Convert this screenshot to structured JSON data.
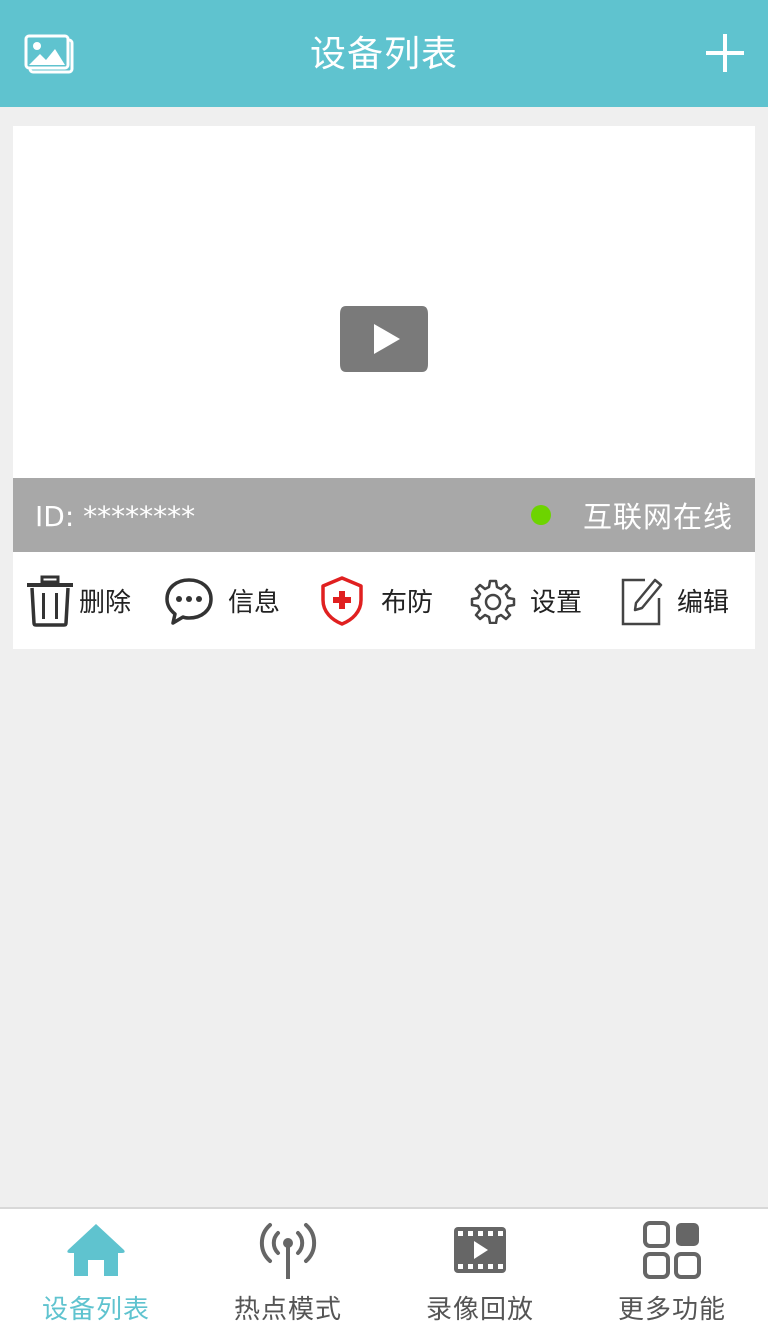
{
  "header": {
    "title": "设备列表",
    "left_icon": "gallery-icon",
    "right_icon": "plus-icon"
  },
  "device": {
    "id_label": "ID: ********",
    "status": "互联网在线",
    "status_color": "#6dd400",
    "play_icon": "play-icon",
    "actions": [
      {
        "label": "删除",
        "icon": "trash-icon"
      },
      {
        "label": "信息",
        "icon": "chat-bubble-icon"
      },
      {
        "label": "布防",
        "icon": "shield-icon"
      },
      {
        "label": "设置",
        "icon": "gear-icon"
      },
      {
        "label": "编辑",
        "icon": "edit-icon"
      }
    ]
  },
  "bottom_nav": {
    "items": [
      {
        "label": "设备列表",
        "icon": "home-icon",
        "active": true
      },
      {
        "label": "热点模式",
        "icon": "antenna-icon",
        "active": false
      },
      {
        "label": "录像回放",
        "icon": "video-playback-icon",
        "active": false
      },
      {
        "label": "更多功能",
        "icon": "grid-icon",
        "active": false
      }
    ]
  },
  "colors": {
    "accent": "#5fc3cf",
    "info_bar": "#a8a8a8",
    "background": "#efefef",
    "shield_red": "#e02020"
  }
}
